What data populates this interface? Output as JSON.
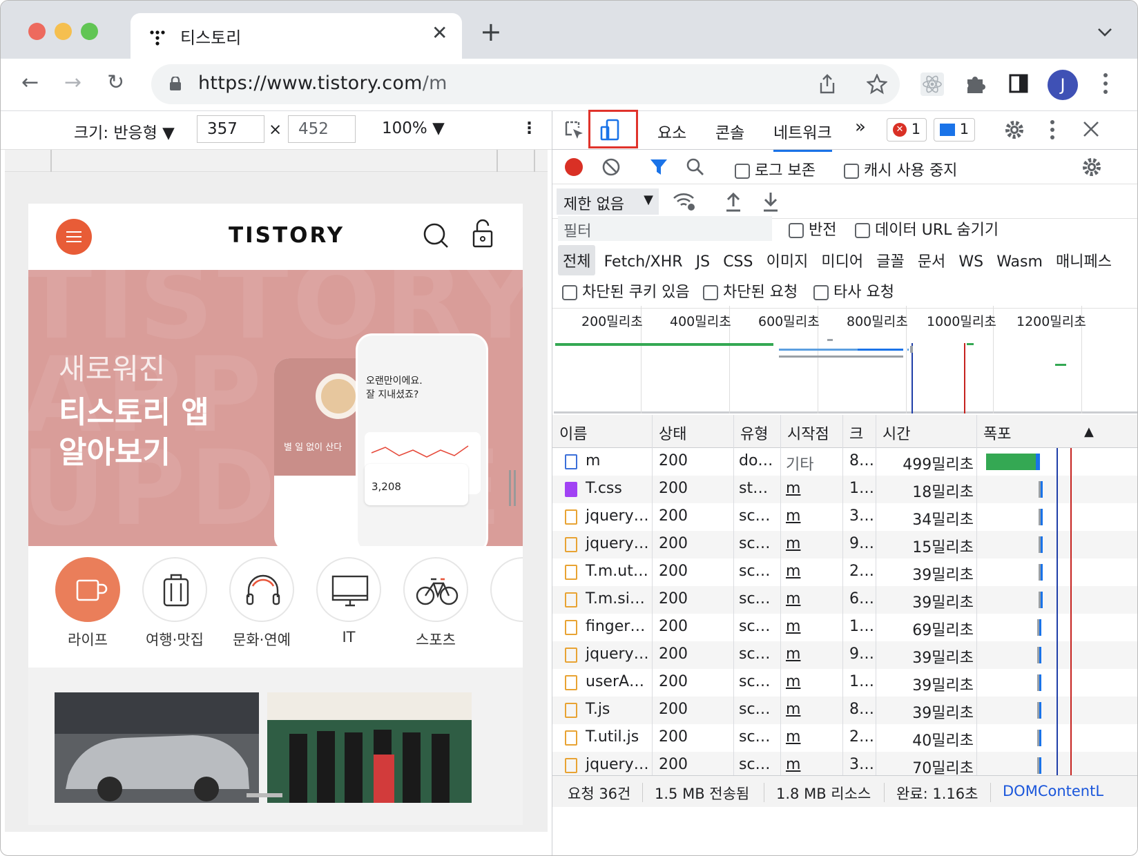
{
  "window": {
    "traffic": [
      "#ed6a5e",
      "#f5bf4f",
      "#61c554"
    ]
  },
  "tab": {
    "title": "티스토리",
    "close": "✕",
    "new_tab": "+",
    "overflow": "⌄"
  },
  "toolbar": {
    "back": "←",
    "forward": "→",
    "reload": "↻",
    "url_host": "https://www.tistory.com",
    "url_path": "/m",
    "avatar": "J"
  },
  "device_toolbar": {
    "size_label": "크기: 반응형 ▼",
    "width": "357",
    "times": "×",
    "height": "452",
    "zoom": "100% ▼",
    "more": "⋮"
  },
  "mobile": {
    "logo": "TISTORY",
    "hero": {
      "bg": "TISTORY APP UPDATE",
      "line1": "새로워진",
      "line2": "티스토리 앱",
      "line3": "알아보기",
      "phone_greeting": "오랜만이에요.\n잘 지내셨죠?",
      "phone_caption": "별 일 없이 산다",
      "phone_stat": "3,208"
    },
    "categories": [
      {
        "label": "라이프",
        "icon": "cup-icon"
      },
      {
        "label": "여행·맛집",
        "icon": "luggage-icon"
      },
      {
        "label": "문화·연예",
        "icon": "headphones-icon"
      },
      {
        "label": "IT",
        "icon": "monitor-icon"
      },
      {
        "label": "스포츠",
        "icon": "bicycle-icon"
      }
    ]
  },
  "devtools": {
    "tabs": [
      "요소",
      "콘솔",
      "네트워크"
    ],
    "active_tab": "네트워크",
    "more_tabs": "»",
    "errors": "1",
    "messages": "1",
    "preserve_log": "로그 보존",
    "disable_cache": "캐시 사용 중지",
    "throttling": "제한 없음",
    "filter_placeholder": "필터",
    "invert": "반전",
    "hide_data_urls": "데이터 URL 숨기기",
    "types": [
      "전체",
      "Fetch/XHR",
      "JS",
      "CSS",
      "이미지",
      "미디어",
      "글꼴",
      "문서",
      "WS",
      "Wasm",
      "매니페스"
    ],
    "blocked_cookies": "차단된 쿠키 있음",
    "blocked_requests": "차단된 요청",
    "third_party": "타사 요청",
    "overview_ticks": [
      "200밀리초",
      "400밀리초",
      "600밀리초",
      "800밀리초",
      "1000밀리초",
      "1200밀리초"
    ],
    "columns": [
      "이름",
      "상태",
      "유형",
      "시작점",
      "크",
      "시간",
      "폭포"
    ],
    "sort_arrow": "▲",
    "requests": [
      {
        "name": "m",
        "status": "200",
        "type": "do…",
        "initiator": "기타",
        "size": "8…",
        "time": "499밀리초",
        "kind": "doc"
      },
      {
        "name": "T.css",
        "status": "200",
        "type": "st…",
        "initiator": "m",
        "size": "1…",
        "time": "18밀리초",
        "kind": "css"
      },
      {
        "name": "jquery…",
        "status": "200",
        "type": "sc…",
        "initiator": "m",
        "size": "3…",
        "time": "34밀리초",
        "kind": "js"
      },
      {
        "name": "jquery…",
        "status": "200",
        "type": "sc…",
        "initiator": "m",
        "size": "9…",
        "time": "15밀리초",
        "kind": "js"
      },
      {
        "name": "T.m.ut…",
        "status": "200",
        "type": "sc…",
        "initiator": "m",
        "size": "2…",
        "time": "39밀리초",
        "kind": "js"
      },
      {
        "name": "T.m.si…",
        "status": "200",
        "type": "sc…",
        "initiator": "m",
        "size": "6…",
        "time": "39밀리초",
        "kind": "js"
      },
      {
        "name": "finger…",
        "status": "200",
        "type": "sc…",
        "initiator": "m",
        "size": "1…",
        "time": "69밀리초",
        "kind": "js"
      },
      {
        "name": "jquery…",
        "status": "200",
        "type": "sc…",
        "initiator": "m",
        "size": "9…",
        "time": "39밀리초",
        "kind": "js"
      },
      {
        "name": "userA…",
        "status": "200",
        "type": "sc…",
        "initiator": "m",
        "size": "1…",
        "time": "39밀리초",
        "kind": "js"
      },
      {
        "name": "T.js",
        "status": "200",
        "type": "sc…",
        "initiator": "m",
        "size": "8…",
        "time": "39밀리초",
        "kind": "js"
      },
      {
        "name": "T.util.js",
        "status": "200",
        "type": "sc…",
        "initiator": "m",
        "size": "2…",
        "time": "40밀리초",
        "kind": "js"
      },
      {
        "name": "jquery…",
        "status": "200",
        "type": "sc…",
        "initiator": "m",
        "size": "3…",
        "time": "70밀리초",
        "kind": "js"
      }
    ],
    "status_bar": {
      "requests": "요청 36건",
      "transferred": "1.5 MB 전송됨",
      "resources": "1.8 MB 리소스",
      "finish": "완료: 1.16초",
      "dcl": "DOMContentL"
    }
  }
}
